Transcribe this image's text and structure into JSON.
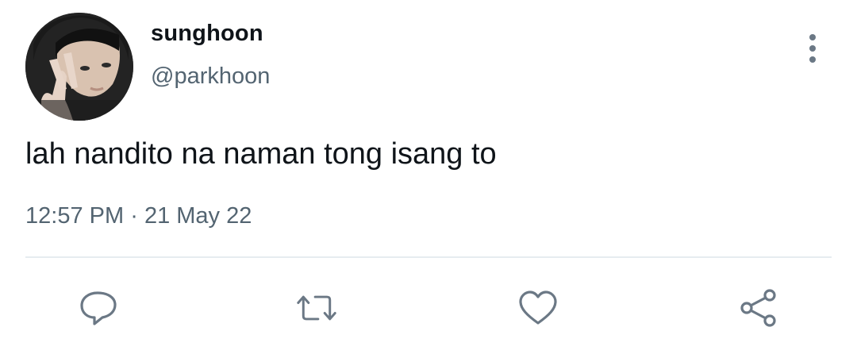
{
  "user": {
    "name": "sunghoon",
    "handle": "@parkhoon"
  },
  "tweet": {
    "text": "lah nandito na naman tong isang to",
    "time": "12:57 PM",
    "separator": "·",
    "date": "21 May 22"
  },
  "icons": {
    "more": "more-vertical-icon",
    "reply": "reply-icon",
    "retweet": "retweet-icon",
    "like": "heart-icon",
    "share": "share-icon"
  },
  "colors": {
    "text": "#0f1419",
    "secondary": "#536471",
    "icon": "#6b7885",
    "divider": "#e6ecf0"
  }
}
